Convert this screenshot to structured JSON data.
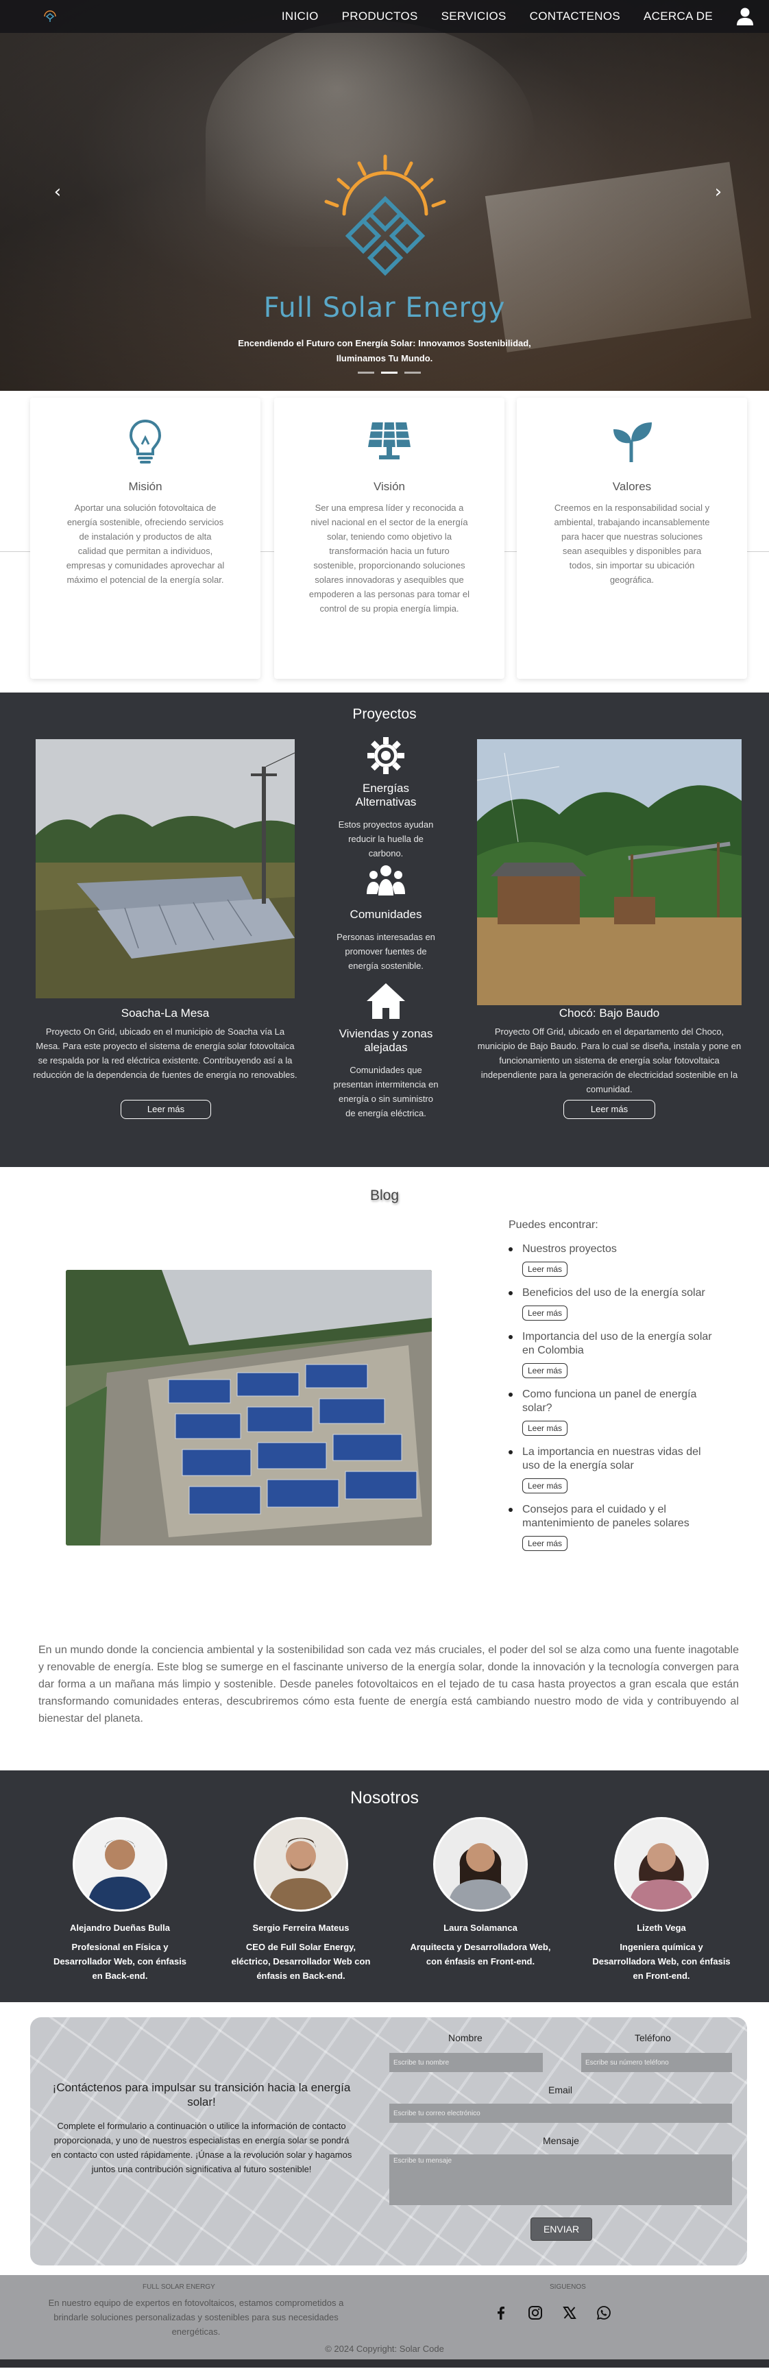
{
  "nav": {
    "items": [
      "INICIO",
      "PRODUCTOS",
      "SERVICIOS",
      "CONTACTENOS",
      "ACERCA DE"
    ],
    "logo_icon": "sun-panel-logo-icon",
    "user_icon": "user-icon"
  },
  "hero": {
    "brand": "Full Solar Energy",
    "tagline_1": "Encendiendo el Futuro con Energía Solar: Innovamos Sostenibilidad,",
    "tagline_2": "Iluminamos Tu Mundo.",
    "slides": 3,
    "active_slide": 2,
    "prev_icon": "chevron-left-icon",
    "next_icon": "chevron-right-icon"
  },
  "mvv": [
    {
      "icon": "lightbulb-icon",
      "title": "Misión",
      "text": "Aportar una solución fotovoltaica de energía sostenible, ofreciendo servicios de instalación y productos de alta calidad que permitan a individuos, empresas y comunidades aprovechar al máximo el potencial de la energía solar."
    },
    {
      "icon": "solar-panel-icon",
      "title": "Visión",
      "text": "Ser una empresa líder y reconocida a nivel nacional en el sector de la energía solar, teniendo como objetivo la transformación hacia un futuro sostenible, proporcionando soluciones solares innovadoras y asequibles que empoderen a las personas para tomar el control de su propia energía limpia."
    },
    {
      "icon": "sprout-icon",
      "title": "Valores",
      "text": "Creemos en la responsabilidad social y ambiental, trabajando incansablemente para hacer que nuestras soluciones sean asequibles y disponibles para todos, sin importar su ubicación geográfica."
    }
  ],
  "proyectos": {
    "title": "Proyectos",
    "left": {
      "name": "Soacha-La Mesa",
      "desc": "Proyecto On Grid, ubicado en el municipio de Soacha vía La Mesa. Para este proyecto el sistema de energía solar fotovoltaica se respalda por la red eléctrica existente. Contribuyendo así a la reducción de la dependencia de fuentes de energía no renovables.",
      "button": "Leer más"
    },
    "right": {
      "name": "Chocó: Bajo Baudo",
      "desc": "Proyecto Off Grid, ubicado en el departamento del Choco, municipio de Bajo Baudo. Para lo cual se diseña, instala y pone en funcionamiento un sistema de energía solar fotovoltaica independiente para la generación de electricidad sostenible en la comunidad.",
      "button": "Leer más"
    },
    "features": [
      {
        "icon": "gear-sun-icon",
        "title": "Energías Alternativas",
        "text": "Estos proyectos ayudan reducir la huella de carbono."
      },
      {
        "icon": "people-group-icon",
        "title": "Comunidades",
        "text": "Personas interesadas en promover fuentes de energía sostenible."
      },
      {
        "icon": "house-icon",
        "title": "Viviendas y zonas alejadas",
        "text": "Comunidades que presentan intermitencia en energía o sin suministro de energía eléctrica."
      }
    ]
  },
  "blog": {
    "title": "Blog",
    "intro": "Puedes encontrar:",
    "items": [
      {
        "title": "Nuestros proyectos",
        "button": "Leer más"
      },
      {
        "title": "Beneficios del uso de la energía solar",
        "button": "Leer más"
      },
      {
        "title": "Importancia del uso de la energía solar en Colombia",
        "button": "Leer más"
      },
      {
        "title": "Como funciona un panel de energía solar?",
        "button": "Leer más"
      },
      {
        "title": "La importancia en nuestras vidas del uso de la energía solar",
        "button": "Leer más"
      },
      {
        "title": "Consejos para el cuidado y el mantenimiento de paneles solares",
        "button": "Leer más"
      }
    ],
    "paragraph": "En un mundo donde la conciencia ambiental y la sostenibilidad son cada vez más cruciales, el poder del sol se alza como una fuente inagotable y renovable de energía. Este blog se sumerge en el fascinante universo de la energía solar, donde la innovación y la tecnología convergen para dar forma a un mañana más limpio y sostenible. Desde paneles fotovoltaicos en el tejado de tu casa hasta proyectos a gran escala que están transformando comunidades enteras, descubriremos cómo esta fuente de energía está cambiando nuestro modo de vida y contribuyendo al bienestar del planeta."
  },
  "nosotros": {
    "title": "Nosotros",
    "members": [
      {
        "name": "Alejandro Dueñas Bulla",
        "role": "Profesional en Física y Desarrollador Web, con énfasis en Back-end."
      },
      {
        "name": "Sergio Ferreira Mateus",
        "role": "CEO de Full Solar Energy, eléctrico, Desarrollador Web con énfasis en Back-end."
      },
      {
        "name": "Laura Solamanca",
        "role": "Arquitecta y Desarrolladora Web, con énfasis en Front-end."
      },
      {
        "name": "Lizeth Vega",
        "role": "Ingeniera química y Desarrolladora Web, con énfasis en Front-end."
      }
    ]
  },
  "contact": {
    "heading": "¡Contáctenos para impulsar su transición hacia la energía solar!",
    "text": "Complete el formulario a continuación o utilice la información de contacto proporcionada, y uno de nuestros especialistas en energía solar se pondrá en contacto con usted rápidamente. ¡Únase a la revolución solar y hagamos juntos una contribución significativa al futuro sostenible!",
    "name_label": "Nombre",
    "name_placeholder": "Escribe tu nombre",
    "phone_label": "Teléfono",
    "phone_placeholder": "Escribe su número teléfono",
    "email_label": "Email",
    "email_placeholder": "Escribe tu correo electrónico",
    "message_label": "Mensaje",
    "message_placeholder": "Escribe tu mensaje",
    "send": "ENVIAR"
  },
  "footer": {
    "brand_title": "FULL SOLAR ENERGY",
    "desc": "En nuestro equipo de expertos en fotovoltaicos, estamos comprometidos a brindarle soluciones personalizadas y sostenibles para sus necesidades energéticas.",
    "follow_title": "SIGUENOS",
    "social": [
      "facebook-icon",
      "instagram-icon",
      "x-twitter-icon",
      "whatsapp-icon"
    ],
    "copyright": "© 2024 Copyright: Solar Code"
  }
}
